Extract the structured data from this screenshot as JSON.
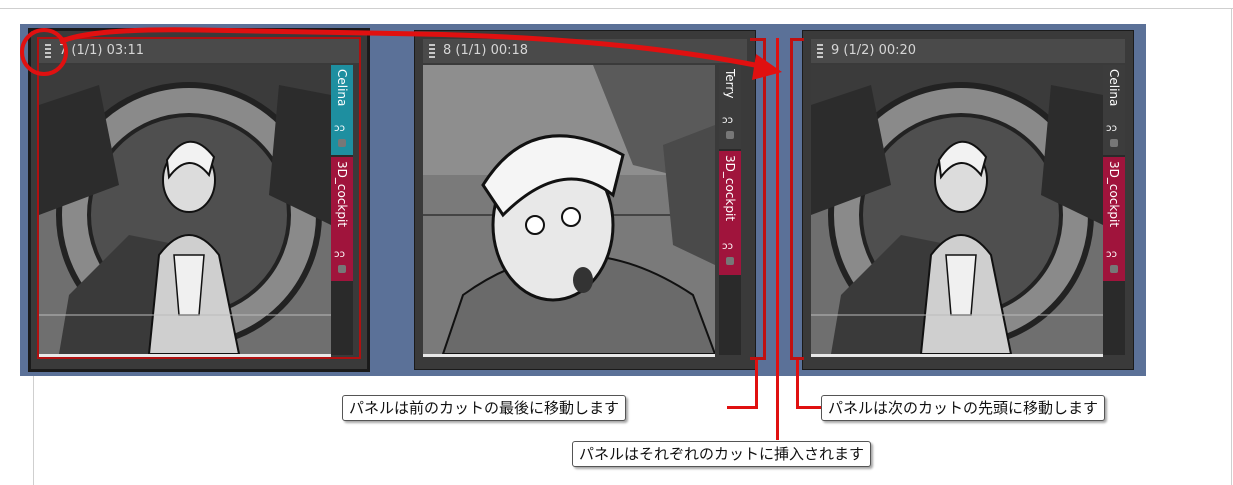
{
  "panels": [
    {
      "header": "7 (1/1) 03:11",
      "layers": [
        {
          "name": "Celina",
          "color": "#1e8fa0"
        },
        {
          "name": "3D_cockpit",
          "color": "#a0143c"
        }
      ]
    },
    {
      "header": "8 (1/1) 00:18",
      "layers": [
        {
          "name": "Terry",
          "color": "#3c3c3c"
        },
        {
          "name": "3D_cockpit",
          "color": "#a0143c"
        }
      ]
    },
    {
      "header": "9 (1/2) 00:20",
      "layers": [
        {
          "name": "Celina",
          "color": "#3c3c3c"
        },
        {
          "name": "3D_cockpit",
          "color": "#a0143c"
        }
      ]
    }
  ],
  "callouts": {
    "move_end_prev": "パネルは前のカットの最後に移動します",
    "insert_each": "パネルはそれぞれのカットに挿入されます",
    "move_start_next": "パネルは次のカットの先頭に移動します"
  },
  "colors": {
    "strip_bg": "#5b7198",
    "annotation_red": "#e01010",
    "selection_red": "#b01010"
  },
  "icons": {
    "grip": "drag-grip-icon",
    "visibility": "eye-icon",
    "lock": "lock-icon"
  }
}
